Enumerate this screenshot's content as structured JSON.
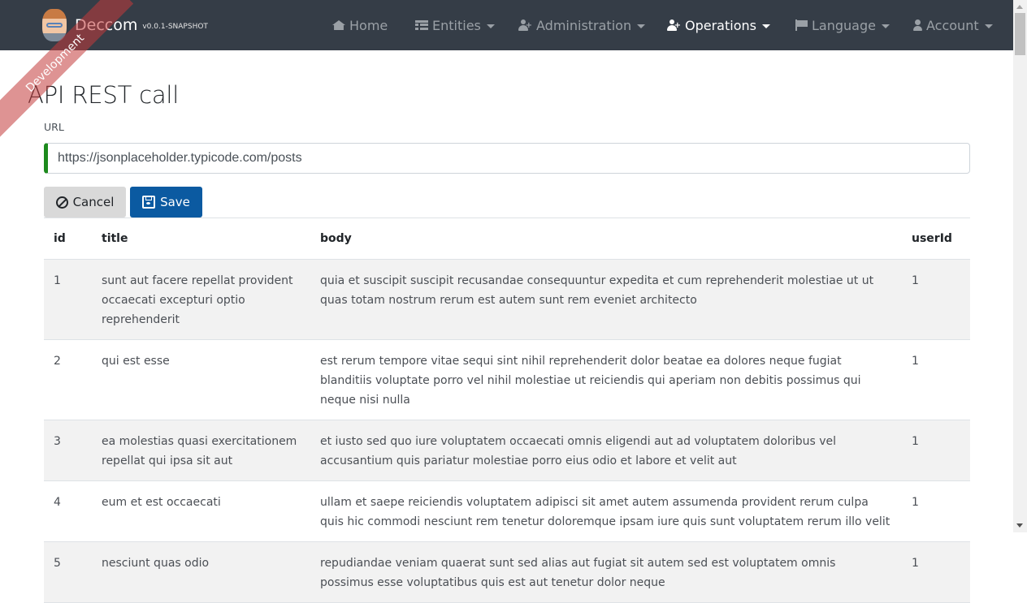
{
  "brand": {
    "title": "Deccom",
    "version": "v0.0.1-SNAPSHOT",
    "ribbon": "Development"
  },
  "nav": {
    "items": [
      {
        "label": "Home",
        "icon": "home-icon",
        "dropdown": false
      },
      {
        "label": "Entities",
        "icon": "table-icon",
        "dropdown": true
      },
      {
        "label": "Administration",
        "icon": "user-plus-icon",
        "dropdown": true
      },
      {
        "label": "Operations",
        "icon": "user-plus-icon",
        "dropdown": true,
        "active": true
      },
      {
        "label": "Language",
        "icon": "flag-icon",
        "dropdown": true
      },
      {
        "label": "Account",
        "icon": "user-icon",
        "dropdown": true
      }
    ]
  },
  "page": {
    "title": "API REST call",
    "url_label": "URL",
    "url_value": "https://jsonplaceholder.typicode.com/posts",
    "cancel_label": "Cancel",
    "save_label": "Save"
  },
  "table": {
    "headers": [
      "id",
      "title",
      "body",
      "userId"
    ],
    "rows": [
      {
        "id": "1",
        "title": "sunt aut facere repellat provident occaecati excepturi optio reprehenderit",
        "body": "quia et suscipit suscipit recusandae consequuntur expedita et cum reprehenderit molestiae ut ut quas totam nostrum rerum est autem sunt rem eveniet architecto",
        "userId": "1"
      },
      {
        "id": "2",
        "title": "qui est esse",
        "body": "est rerum tempore vitae sequi sint nihil reprehenderit dolor beatae ea dolores neque fugiat blanditiis voluptate porro vel nihil molestiae ut reiciendis qui aperiam non debitis possimus qui neque nisi nulla",
        "userId": "1"
      },
      {
        "id": "3",
        "title": "ea molestias quasi exercitationem repellat qui ipsa sit aut",
        "body": "et iusto sed quo iure voluptatem occaecati omnis eligendi aut ad voluptatem doloribus vel accusantium quis pariatur molestiae porro eius odio et labore et velit aut",
        "userId": "1"
      },
      {
        "id": "4",
        "title": "eum et est occaecati",
        "body": "ullam et saepe reiciendis voluptatem adipisci sit amet autem assumenda provident rerum culpa quis hic commodi nesciunt rem tenetur doloremque ipsam iure quis sunt voluptatem rerum illo velit",
        "userId": "1"
      },
      {
        "id": "5",
        "title": "nesciunt quas odio",
        "body": "repudiandae veniam quaerat sunt sed alias aut fugiat sit autem sed est voluptatem omnis possimus esse voluptatibus quis est aut tenetur dolor neque",
        "userId": "1"
      }
    ]
  },
  "colors": {
    "navbar": "#353d47",
    "save_button": "#0b5aa1",
    "input_accent": "#1d8a1d",
    "ribbon": "#c23b3b"
  }
}
